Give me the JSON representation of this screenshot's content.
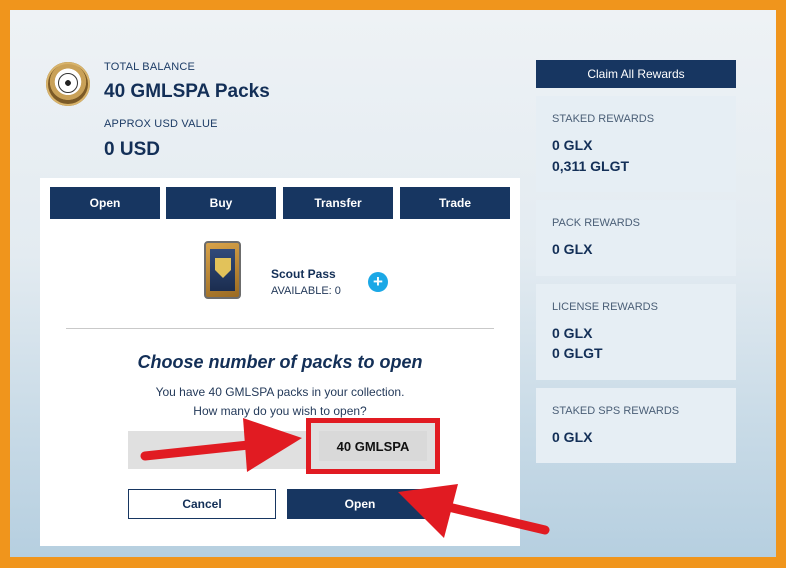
{
  "balance": {
    "total_label": "TOTAL BALANCE",
    "total_value": "40 GMLSPA Packs",
    "usd_label": "APPROX USD VALUE",
    "usd_value": "0 USD"
  },
  "tabs": [
    "Open",
    "Buy",
    "Transfer",
    "Trade"
  ],
  "pack": {
    "name": "Scout Pass",
    "available": "AVAILABLE: 0"
  },
  "open_dialog": {
    "heading": "Choose number of packs to open",
    "line1": "You have 40 GMLSPA packs in your collection.",
    "line2": "How many do you wish to open?",
    "amount": "40 GMLSPA",
    "cancel_label": "Cancel",
    "open_label": "Open"
  },
  "rewards": {
    "claim_label": "Claim All Rewards",
    "staked": {
      "title": "STAKED REWARDS",
      "values": [
        "0 GLX",
        "0,311 GLGT"
      ]
    },
    "pack": {
      "title": "PACK REWARDS",
      "values": [
        "0 GLX"
      ]
    },
    "license": {
      "title": "LICENSE REWARDS",
      "values": [
        "0 GLX",
        "0 GLGT"
      ]
    },
    "staked_sps": {
      "title": "STAKED SPS REWARDS",
      "values": [
        "0 GLX"
      ]
    }
  },
  "colors": {
    "navy": "#173661",
    "accent_blue": "#1ba8e6",
    "highlight_red": "#e11b22",
    "frame_orange": "#f0951c"
  },
  "icons": {
    "emblem": "soccer-ball-emblem",
    "add": "plus-circle-icon",
    "annotation": "red-arrow"
  }
}
